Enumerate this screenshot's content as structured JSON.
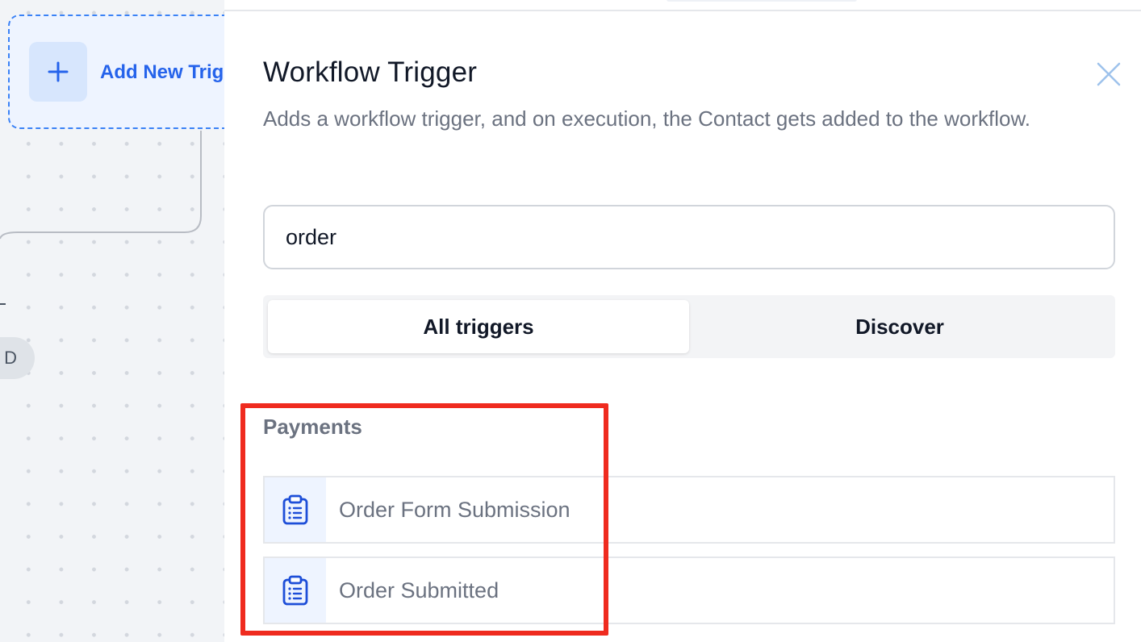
{
  "canvas": {
    "trigger_node_label": "Add New Trig",
    "end_pill_text": "D"
  },
  "drawer": {
    "title": "Workflow Trigger",
    "description": "Adds a workflow trigger, and on execution, the Contact gets added to the workflow.",
    "search": {
      "value": "order",
      "placeholder": ""
    },
    "tabs": [
      {
        "label": "All triggers",
        "active": true
      },
      {
        "label": "Discover",
        "active": false
      }
    ],
    "sections": [
      {
        "heading": "Payments",
        "items": [
          {
            "label": "Order Form Submission",
            "icon": "clipboard-list-icon"
          },
          {
            "label": "Order Submitted",
            "icon": "clipboard-list-icon"
          }
        ]
      }
    ]
  },
  "colors": {
    "accent": "#2563eb",
    "highlight": "#ef2b1f",
    "icon_bg": "#eef4ff"
  }
}
